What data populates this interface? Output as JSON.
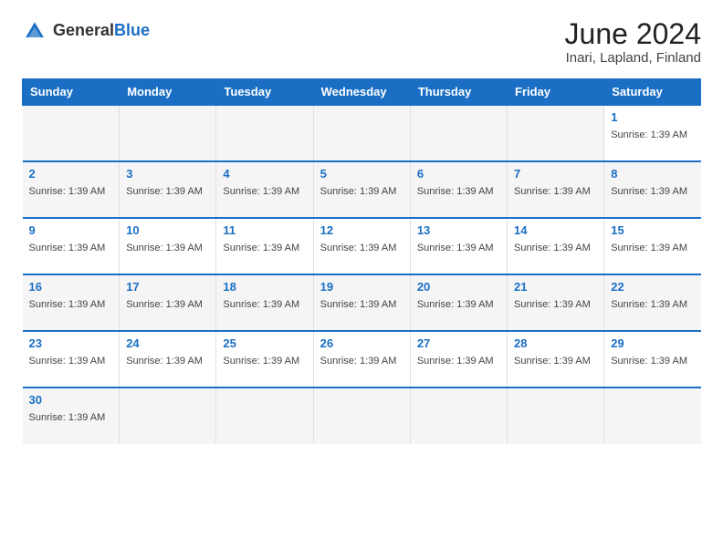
{
  "header": {
    "logo_general": "General",
    "logo_blue": "Blue",
    "month_title": "June 2024",
    "location": "Inari, Lapland, Finland"
  },
  "days_of_week": [
    "Sunday",
    "Monday",
    "Tuesday",
    "Wednesday",
    "Thursday",
    "Friday",
    "Saturday"
  ],
  "sunrise_text": "Sunrise: 1:39 AM",
  "weeks": [
    {
      "days": [
        {
          "num": "",
          "info": ""
        },
        {
          "num": "",
          "info": ""
        },
        {
          "num": "",
          "info": ""
        },
        {
          "num": "",
          "info": ""
        },
        {
          "num": "",
          "info": ""
        },
        {
          "num": "",
          "info": ""
        },
        {
          "num": "1",
          "info": "Sunrise: 1:39 AM"
        }
      ]
    },
    {
      "days": [
        {
          "num": "2",
          "info": "Sunrise: 1:39 AM"
        },
        {
          "num": "3",
          "info": "Sunrise: 1:39 AM"
        },
        {
          "num": "4",
          "info": "Sunrise: 1:39 AM"
        },
        {
          "num": "5",
          "info": "Sunrise: 1:39 AM"
        },
        {
          "num": "6",
          "info": "Sunrise: 1:39 AM"
        },
        {
          "num": "7",
          "info": "Sunrise: 1:39 AM"
        },
        {
          "num": "8",
          "info": "Sunrise: 1:39 AM"
        }
      ]
    },
    {
      "days": [
        {
          "num": "9",
          "info": "Sunrise: 1:39 AM"
        },
        {
          "num": "10",
          "info": "Sunrise: 1:39 AM"
        },
        {
          "num": "11",
          "info": "Sunrise: 1:39 AM"
        },
        {
          "num": "12",
          "info": "Sunrise: 1:39 AM"
        },
        {
          "num": "13",
          "info": "Sunrise: 1:39 AM"
        },
        {
          "num": "14",
          "info": "Sunrise: 1:39 AM"
        },
        {
          "num": "15",
          "info": "Sunrise: 1:39 AM"
        }
      ]
    },
    {
      "days": [
        {
          "num": "16",
          "info": "Sunrise: 1:39 AM"
        },
        {
          "num": "17",
          "info": "Sunrise: 1:39 AM"
        },
        {
          "num": "18",
          "info": "Sunrise: 1:39 AM"
        },
        {
          "num": "19",
          "info": "Sunrise: 1:39 AM"
        },
        {
          "num": "20",
          "info": "Sunrise: 1:39 AM"
        },
        {
          "num": "21",
          "info": "Sunrise: 1:39 AM"
        },
        {
          "num": "22",
          "info": "Sunrise: 1:39 AM"
        }
      ]
    },
    {
      "days": [
        {
          "num": "23",
          "info": "Sunrise: 1:39 AM"
        },
        {
          "num": "24",
          "info": "Sunrise: 1:39 AM"
        },
        {
          "num": "25",
          "info": "Sunrise: 1:39 AM"
        },
        {
          "num": "26",
          "info": "Sunrise: 1:39 AM"
        },
        {
          "num": "27",
          "info": "Sunrise: 1:39 AM"
        },
        {
          "num": "28",
          "info": "Sunrise: 1:39 AM"
        },
        {
          "num": "29",
          "info": "Sunrise: 1:39 AM"
        }
      ]
    },
    {
      "days": [
        {
          "num": "30",
          "info": "Sunrise: 1:39 AM"
        },
        {
          "num": "",
          "info": ""
        },
        {
          "num": "",
          "info": ""
        },
        {
          "num": "",
          "info": ""
        },
        {
          "num": "",
          "info": ""
        },
        {
          "num": "",
          "info": ""
        },
        {
          "num": "",
          "info": ""
        }
      ]
    }
  ]
}
